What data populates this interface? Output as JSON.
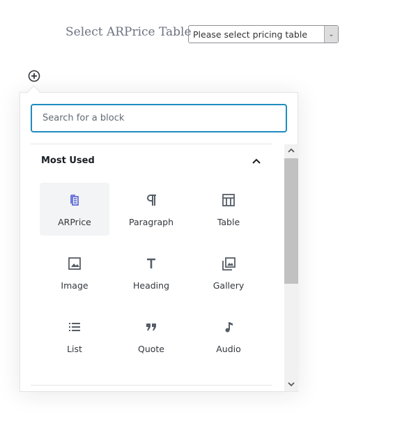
{
  "header": {
    "label": "Select ARPrice Table",
    "select_value": "Please select pricing table"
  },
  "inserter": {
    "search_placeholder": "Search for a block",
    "panel_title": "Most Used",
    "accent": "#1e8cbe",
    "items": [
      {
        "label": "ARPrice",
        "icon": "arprice-icon"
      },
      {
        "label": "Paragraph",
        "icon": "paragraph-icon"
      },
      {
        "label": "Table",
        "icon": "table-icon"
      },
      {
        "label": "Image",
        "icon": "image-icon"
      },
      {
        "label": "Heading",
        "icon": "heading-icon"
      },
      {
        "label": "Gallery",
        "icon": "gallery-icon"
      },
      {
        "label": "List",
        "icon": "list-icon"
      },
      {
        "label": "Quote",
        "icon": "quote-icon"
      },
      {
        "label": "Audio",
        "icon": "audio-icon"
      }
    ]
  }
}
